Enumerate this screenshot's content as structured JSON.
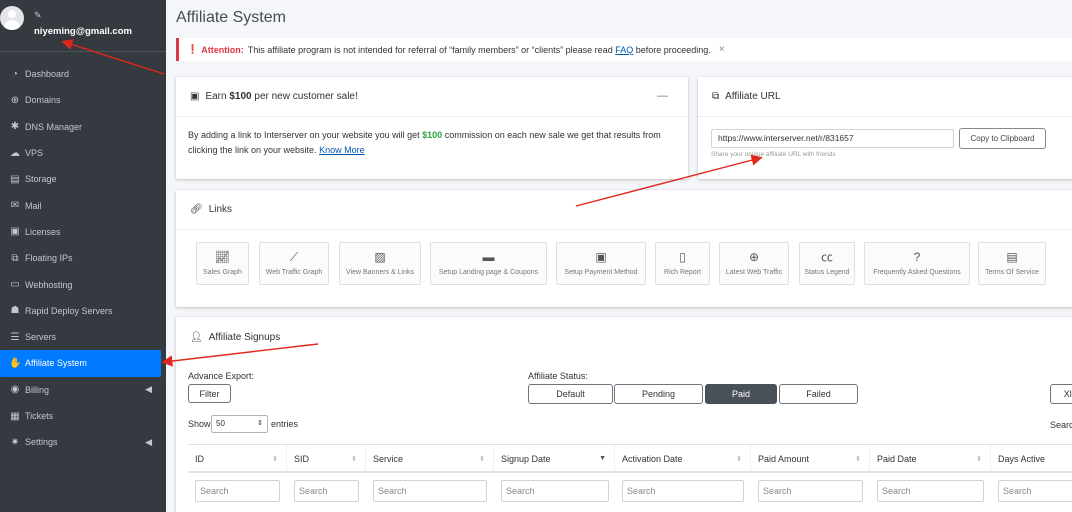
{
  "user": {
    "email": "niyeming@gmail.com"
  },
  "sidebar": {
    "items": [
      {
        "label": "Dashboard",
        "icon": "dashboard-icon"
      },
      {
        "label": "Domains",
        "icon": "globe-icon"
      },
      {
        "label": "DNS Manager",
        "icon": "gear-icon"
      },
      {
        "label": "VPS",
        "icon": "cloud-icon"
      },
      {
        "label": "Storage",
        "icon": "hdd-icon"
      },
      {
        "label": "Mail",
        "icon": "envelope-icon"
      },
      {
        "label": "Licenses",
        "icon": "id-card-icon"
      },
      {
        "label": "Floating IPs",
        "icon": "network-icon"
      },
      {
        "label": "Webhosting",
        "icon": "server-icon"
      },
      {
        "label": "Rapid Deploy Servers",
        "icon": "rocket-icon"
      },
      {
        "label": "Servers",
        "icon": "server-icon"
      },
      {
        "label": "Affiliate System",
        "icon": "handshake-icon"
      },
      {
        "label": "Billing",
        "icon": "coins-icon"
      },
      {
        "label": "Tickets",
        "icon": "ticket-icon"
      },
      {
        "label": "Settings",
        "icon": "gear-icon"
      }
    ],
    "active_index": 11,
    "accent": "#007bff"
  },
  "page": {
    "title": "Affiliate System"
  },
  "alert": {
    "label": "Attention:",
    "text": "This affiliate program is not intended for referral of “family members” or “clients” please read",
    "link": "FAQ",
    "after": "before proceeding.",
    "close": "×"
  },
  "earn": {
    "pre": "Earn",
    "amount": "$100",
    "post": "per new customer sale!",
    "body_pre": "By adding a link to Interserver on your website you will get",
    "body_amount": "$100",
    "body_post": "commission on each new sale we get that results from clicking the link on your website.",
    "link": "Know More"
  },
  "affiliate_url": {
    "title": "Affiliate URL",
    "value": "https://www.interserver.net/r/831657",
    "button": "Copy to Clipboard",
    "help": "Share your unique affiliate URL with friends"
  },
  "links": {
    "title": "Links",
    "tiles": [
      {
        "label": "Sales Graph",
        "icon": "chart-area-icon"
      },
      {
        "label": "Web Traffic Graph",
        "icon": "chart-line-icon"
      },
      {
        "label": "View Banners & Links",
        "icon": "image-icon"
      },
      {
        "label": "Setup Landing page & Coupons",
        "icon": "ticket-icon"
      },
      {
        "label": "Setup Payment Method",
        "icon": "money-bill-icon"
      },
      {
        "label": "Rich Report",
        "icon": "file-icon"
      },
      {
        "label": "Latest Web Traffic",
        "icon": "globe-icon"
      },
      {
        "label": "Status Legend",
        "icon": "closed-captioning-icon"
      },
      {
        "label": "Frequently Asked Questions",
        "icon": "question-icon"
      },
      {
        "label": "Terms Of Service",
        "icon": "file-alt-icon"
      }
    ]
  },
  "signups": {
    "title": "Affiliate Signups",
    "advance_export": "Advance Export:",
    "filter": "Filter",
    "status_label": "Affiliate Status:",
    "statuses": [
      "Default",
      "Pending",
      "Paid",
      "Failed"
    ],
    "active_status": "Paid",
    "right_button": "Xls",
    "right_label": "Searc",
    "show": "Show",
    "entries_value": "50",
    "entries": "entries",
    "columns": [
      "ID",
      "SID",
      "Service",
      "Signup Date",
      "Activation Date",
      "Paid Amount",
      "Paid Date",
      "Days Active"
    ],
    "search_placeholder": "Search"
  }
}
